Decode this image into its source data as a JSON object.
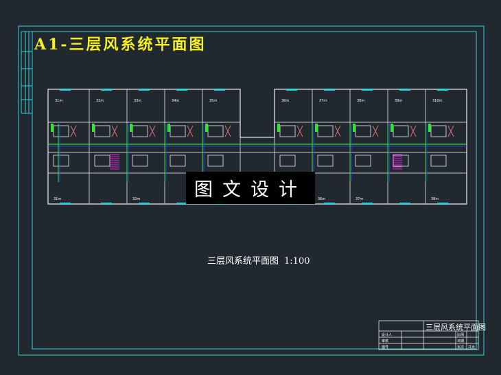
{
  "drawing": {
    "title": "A1-三层风系统平面图",
    "caption": "三层风系统平面图",
    "scale": "1:100",
    "watermark": "图文设计"
  },
  "rooms": {
    "top": [
      "31m",
      "32m",
      "33m",
      "34m",
      "35m",
      "36m",
      "37m",
      "38m",
      "39m",
      "310m"
    ],
    "bottom": [
      "31m",
      "32m",
      "36m",
      "37m",
      "38m"
    ]
  },
  "title_block": {
    "name": "三层风系统平面图",
    "cells": [
      "设计人",
      "审核",
      "图号",
      "比例",
      "日期",
      "页次",
      "共页"
    ]
  },
  "colors": {
    "background": "#212830",
    "frame": "#2fd0d8",
    "wall": "#c8c8c8",
    "duct": "#33e633",
    "title": "#f4f020",
    "stair": "#e020e0"
  }
}
